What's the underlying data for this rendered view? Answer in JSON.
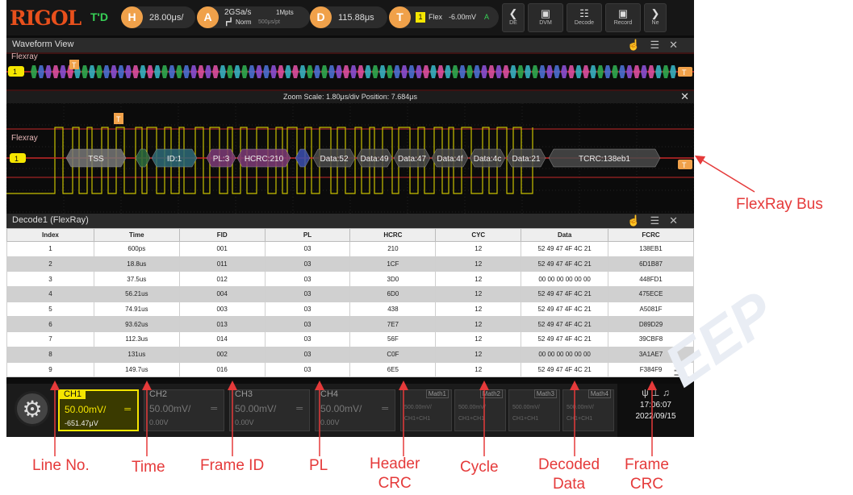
{
  "topbar": {
    "logo": "RIGOL",
    "run_state": "T'D",
    "horizontal": {
      "badge": "H",
      "value": "28.00μs/"
    },
    "acquire": {
      "badge": "A",
      "rate": "2GSa/s",
      "depth": "1Mpts",
      "mode": "Norm",
      "sub": "500μs/pt"
    },
    "delay": {
      "badge": "D",
      "value": "115.88μs"
    },
    "trigger": {
      "badge": "T",
      "channel": "1",
      "type": "Flex",
      "level": "-6.00mV",
      "mode": "A"
    },
    "tools": [
      {
        "icon": "collapse-icon",
        "glyph": "❮",
        "label": "DE"
      },
      {
        "icon": "dvm-icon",
        "glyph": "▣",
        "label": "DVM"
      },
      {
        "icon": "decode-icon",
        "glyph": "☷",
        "label": "Decode"
      },
      {
        "icon": "record-icon",
        "glyph": "▣",
        "label": "Record"
      },
      {
        "icon": "more-icon",
        "glyph": "❯",
        "label": "Ne"
      }
    ]
  },
  "waveform_view": {
    "title": "Waveform View",
    "bus_label": "Flexray"
  },
  "zoom": {
    "text": "Zoom  Scale: 1.80μs/div  Position: 7.684μs",
    "bus_label": "Flexray"
  },
  "bus_segments": [
    "TSS",
    "ID:1",
    "PL:3",
    "HCRC:210",
    "Data:52",
    "Data:49",
    "Data:47",
    "Data:4f",
    "Data:4c",
    "Data:21",
    "TCRC:138eb1"
  ],
  "decode": {
    "title": "Decode1 (FlexRay)",
    "columns": [
      "Index",
      "Time",
      "FID",
      "PL",
      "HCRC",
      "CYC",
      "Data",
      "FCRC"
    ],
    "rows": [
      [
        "1",
        "600ps",
        "001",
        "03",
        "210",
        "12",
        "52 49 47 4F 4C 21",
        "138EB1"
      ],
      [
        "2",
        "18.8us",
        "011",
        "03",
        "1CF",
        "12",
        "52 49 47 4F 4C 21",
        "6D1B87"
      ],
      [
        "3",
        "37.5us",
        "012",
        "03",
        "3D0",
        "12",
        "00 00 00 00 00 00",
        "448FD1"
      ],
      [
        "4",
        "56.21us",
        "004",
        "03",
        "6D0",
        "12",
        "52 49 47 4F 4C 21",
        "475ECE"
      ],
      [
        "5",
        "74.91us",
        "003",
        "03",
        "438",
        "12",
        "52 49 47 4F 4C 21",
        "A5081F"
      ],
      [
        "6",
        "93.62us",
        "013",
        "03",
        "7E7",
        "12",
        "52 49 47 4F 4C 21",
        "D89D29"
      ],
      [
        "7",
        "112.3us",
        "014",
        "03",
        "56F",
        "12",
        "52 49 47 4F 4C 21",
        "39CBF8"
      ],
      [
        "8",
        "131us",
        "002",
        "03",
        "C0F",
        "12",
        "00 00 00 00 00 00",
        "3A1AE7"
      ],
      [
        "9",
        "149.7us",
        "016",
        "03",
        "6E5",
        "12",
        "52 49 47 4F 4C 21",
        "F384F9"
      ]
    ]
  },
  "channels": [
    {
      "name": "CH1",
      "scale": "50.00mV/",
      "offset": "-651.47μV",
      "active": true
    },
    {
      "name": "CH2",
      "scale": "50.00mV/",
      "offset": "0.00V",
      "active": false
    },
    {
      "name": "CH3",
      "scale": "50.00mV/",
      "offset": "0.00V",
      "active": false
    },
    {
      "name": "CH4",
      "scale": "50.00mV/",
      "offset": "0.00V",
      "active": false
    }
  ],
  "maths": [
    {
      "name": "Math1",
      "l1": "500.00mV/",
      "l2": "CH1+CH1"
    },
    {
      "name": "Math2",
      "l1": "500.00mV/",
      "l2": "CH1+CH1"
    },
    {
      "name": "Math3",
      "l1": "500.00mV/",
      "l2": "CH1+CH1"
    },
    {
      "name": "Math4",
      "l1": "500.00mV/",
      "l2": "CH1+CH1"
    }
  ],
  "clock": {
    "time": "17:06:07",
    "date": "2022/09/15"
  },
  "annotations": {
    "flexray_bus": "FlexRay Bus",
    "line_no": "Line No.",
    "time": "Time",
    "frame_id": "Frame ID",
    "pl": "PL",
    "header_crc": "Header\nCRC",
    "cycle": "Cycle",
    "decoded_data": "Decoded\nData",
    "frame_crc": "Frame\nCRC"
  },
  "colors": {
    "annotation": "#e53a3a",
    "ch1": "#f5e600",
    "trigger_marker": "#f0a14a",
    "brand": "#e8501c"
  }
}
